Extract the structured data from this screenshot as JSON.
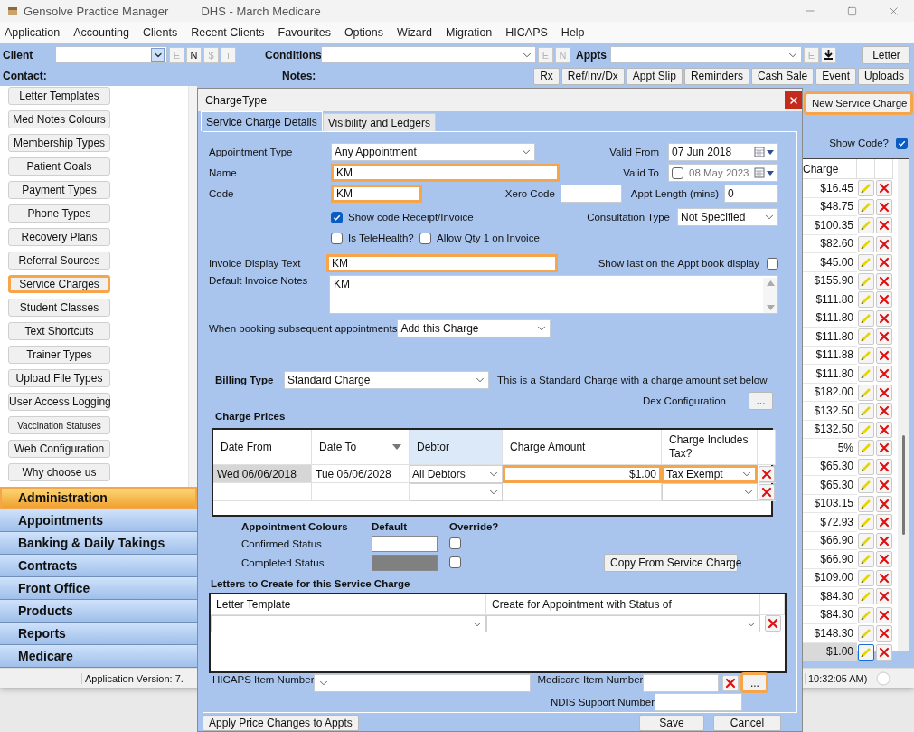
{
  "window": {
    "title": "Gensolve Practice Manager",
    "subtitle": "DHS - March Medicare"
  },
  "menu": [
    "Application",
    "Accounting",
    "Clients",
    "Recent Clients",
    "Favourites",
    "Options",
    "Wizard",
    "Migration",
    "HICAPS",
    "Help"
  ],
  "toolbar": {
    "client": {
      "label": "Client",
      "buttons": [
        {
          "label": "E",
          "disabled": true
        },
        {
          "label": "N",
          "disabled": false
        },
        {
          "label": "$",
          "disabled": true
        },
        {
          "label": "i",
          "disabled": true
        }
      ]
    },
    "conditions": {
      "label": "Conditions",
      "buttons": [
        {
          "label": "E",
          "disabled": true
        },
        {
          "label": "N",
          "disabled": true
        }
      ]
    },
    "appts": {
      "label": "Appts",
      "buttons": [
        {
          "label": "E",
          "disabled": true
        }
      ]
    },
    "letter_button": "Letter"
  },
  "info_bar": {
    "contact_label": "Contact:",
    "notes_label": "Notes:",
    "buttons": [
      "Rx",
      "Ref/Inv/Dx",
      "Appt Slip",
      "Reminders",
      "Cash Sale",
      "Event",
      "Uploads"
    ]
  },
  "sidebar": {
    "items": [
      {
        "label": "Letter Templates",
        "selected": false
      },
      {
        "label": "Med Notes Colours",
        "selected": false
      },
      {
        "label": "Membership Types",
        "selected": false
      },
      {
        "label": "Patient Goals",
        "selected": false
      },
      {
        "label": "Payment Types",
        "selected": false
      },
      {
        "label": "Phone Types",
        "selected": false
      },
      {
        "label": "Recovery Plans",
        "selected": false
      },
      {
        "label": "Referral Sources",
        "selected": false
      },
      {
        "label": "Service Charges",
        "selected": true
      },
      {
        "label": "Student Classes",
        "selected": false
      },
      {
        "label": "Text Shortcuts",
        "selected": false
      },
      {
        "label": "Trainer Types",
        "selected": false
      },
      {
        "label": "Upload File Types",
        "selected": false
      },
      {
        "label": "User Access Logging",
        "selected": false
      },
      {
        "label": "Vaccination Statuses",
        "selected": false
      },
      {
        "label": "Web Configuration",
        "selected": false
      },
      {
        "label": "Why choose us",
        "selected": false
      }
    ],
    "sections": [
      {
        "label": "Administration",
        "selected": true
      },
      {
        "label": "Appointments",
        "selected": false
      },
      {
        "label": "Banking & Daily Takings",
        "selected": false
      },
      {
        "label": "Contracts",
        "selected": false
      },
      {
        "label": "Front Office",
        "selected": false
      },
      {
        "label": "Products",
        "selected": false
      },
      {
        "label": "Reports",
        "selected": false
      },
      {
        "label": "Medicare",
        "selected": false
      }
    ]
  },
  "service_list": {
    "new_button": {
      "label": "New Service Charge",
      "highlighted": true
    },
    "show_code": {
      "label": "Show Code?",
      "checked": true
    },
    "column": "Charge",
    "rows": [
      {
        "amount": "$16.45",
        "selected": false
      },
      {
        "amount": "$48.75",
        "selected": false
      },
      {
        "amount": "$100.35",
        "selected": false
      },
      {
        "amount": "$82.60",
        "selected": false
      },
      {
        "amount": "$45.00",
        "selected": false
      },
      {
        "amount": "$155.90",
        "selected": false
      },
      {
        "amount": "$111.80",
        "selected": false
      },
      {
        "amount": "$111.80",
        "selected": false
      },
      {
        "amount": "$111.80",
        "selected": false
      },
      {
        "amount": "$111.88",
        "selected": false
      },
      {
        "amount": "$111.80",
        "selected": false
      },
      {
        "amount": "$182.00",
        "selected": false
      },
      {
        "amount": "$132.50",
        "selected": false
      },
      {
        "amount": "$132.50",
        "selected": false
      },
      {
        "amount": "5%",
        "selected": false
      },
      {
        "amount": "$65.30",
        "selected": false
      },
      {
        "amount": "$65.30",
        "selected": false
      },
      {
        "amount": "$103.15",
        "selected": false
      },
      {
        "amount": "$72.93",
        "selected": false
      },
      {
        "amount": "$66.90",
        "selected": false
      },
      {
        "amount": "$66.90",
        "selected": false
      },
      {
        "amount": "$109.00",
        "selected": false
      },
      {
        "amount": "$84.30",
        "selected": false
      },
      {
        "amount": "$84.30",
        "selected": false
      },
      {
        "amount": "$148.30",
        "selected": false
      },
      {
        "amount": "$1.00",
        "selected": true
      }
    ]
  },
  "status_bar": {
    "version": "Application Version: 7.",
    "time": "10:32:05 AM)"
  },
  "dialog": {
    "title": "ChargeType",
    "tabs": [
      {
        "label": "Service Charge Details",
        "selected": true
      },
      {
        "label": "Visibility and Ledgers",
        "selected": false
      }
    ],
    "appointment_type": {
      "label": "Appointment Type",
      "value": "Any Appointment"
    },
    "valid_from": {
      "label": "Valid From",
      "value": "07 Jun  2018"
    },
    "valid_to": {
      "label": "Valid To",
      "value": "08 May 2023",
      "checked": false
    },
    "name": {
      "label": "Name",
      "value": "KM",
      "highlighted": true
    },
    "code": {
      "label": "Code",
      "value": "KM",
      "highlighted": true
    },
    "xero_code": {
      "label": "Xero Code"
    },
    "appt_length": {
      "label": "Appt Length (mins)",
      "value": "0"
    },
    "options": [
      {
        "label": "Show code Receipt/Invoice",
        "checked": true
      },
      {
        "label": "Is TeleHealth?",
        "checked": false
      },
      {
        "label": "Allow Qty 1 on Invoice",
        "checked": false
      }
    ],
    "consultation_type": {
      "label": "Consultation Type",
      "value": "Not Specified"
    },
    "invoice_display_text": {
      "label": "Invoice Display Text",
      "value": "KM",
      "highlighted": true
    },
    "show_last": {
      "label": "Show last on the Appt book display",
      "checked": false
    },
    "default_invoice_notes": {
      "label": "Default Invoice Notes",
      "value": "KM"
    },
    "subsequent": {
      "label": "When booking subsequent appointments",
      "value": "Add this Charge"
    },
    "billing_type": {
      "label": "Billing Type",
      "value": "Standard Charge",
      "description": "This is a Standard Charge with a charge amount set below"
    },
    "dex_configuration": {
      "label": "Dex Configuration",
      "button": "..."
    },
    "charge_prices": {
      "title": "Charge Prices",
      "columns": [
        "Date From",
        "Date To",
        "Debtor",
        "Charge Amount",
        "Charge Includes Tax?"
      ],
      "rows": [
        {
          "date_from": "Wed 06/06/2018",
          "date_to": "Tue 06/06/2028",
          "debtor": "All Debtors",
          "amount": "$1.00",
          "tax": "Tax Exempt",
          "highlighted": true
        }
      ]
    },
    "appointment_colours": {
      "title": "Appointment Colours",
      "default_label": "Default",
      "override_label": "Override?",
      "rows": [
        {
          "label": "Confirmed Status",
          "color": "#ffffff",
          "override": false
        },
        {
          "label": "Completed Status",
          "color": "#808080",
          "override": false
        }
      ]
    },
    "copy_button": "Copy From Service Charge",
    "letters": {
      "title": "Letters to Create for this Service Charge",
      "columns": [
        "Letter Template",
        "Create for Appointment with Status of"
      ]
    },
    "hicaps": {
      "label": "HICAPS Item Number"
    },
    "medicare": {
      "label": "Medicare Item Number",
      "button": "...",
      "highlighted": true
    },
    "ndis": {
      "label": "NDIS Support Number"
    },
    "buttons": {
      "apply": "Apply Price Changes to Appts",
      "save": "Save",
      "cancel": "Cancel"
    }
  }
}
